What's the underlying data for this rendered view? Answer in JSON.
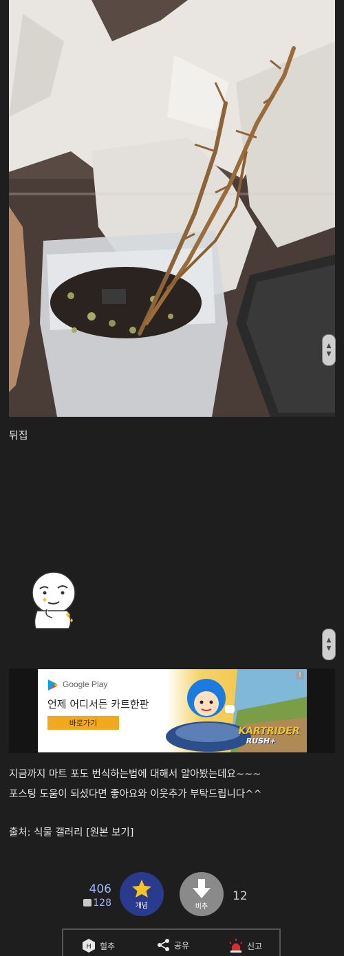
{
  "post": {
    "caption": "뒤집",
    "body_line1": "지금까지 마트 포도 번식하는법에 대해서 알아봤는데요~~~",
    "body_line2": "포스팅 도움이 되셨다면 좋아요와 이웃추가 부탁드립니다^^",
    "source": "출처: 식물 갤러리 [원본 보기]"
  },
  "ad": {
    "store_label": "Google Play",
    "headline": "언제 어디서든 카트한판",
    "cta": "바로가기",
    "game_logo_line1": "KARTRIDER",
    "game_logo_line2": "RUSH+",
    "info_icon": "!"
  },
  "votes": {
    "up_count": "406",
    "up_sub_count": "128",
    "up_label": "개념",
    "down_label": "비추",
    "down_count": "12",
    "up_color": "#2a3a8c",
    "down_color": "#8a8a8a"
  },
  "bottom_bar": {
    "recommend": "힐추",
    "share": "공유",
    "report": "신고"
  },
  "icons": [
    "chevron-up-icon",
    "chevron-down-icon",
    "star-icon",
    "arrow-down-icon",
    "share-icon",
    "siren-icon",
    "google-play-icon"
  ]
}
